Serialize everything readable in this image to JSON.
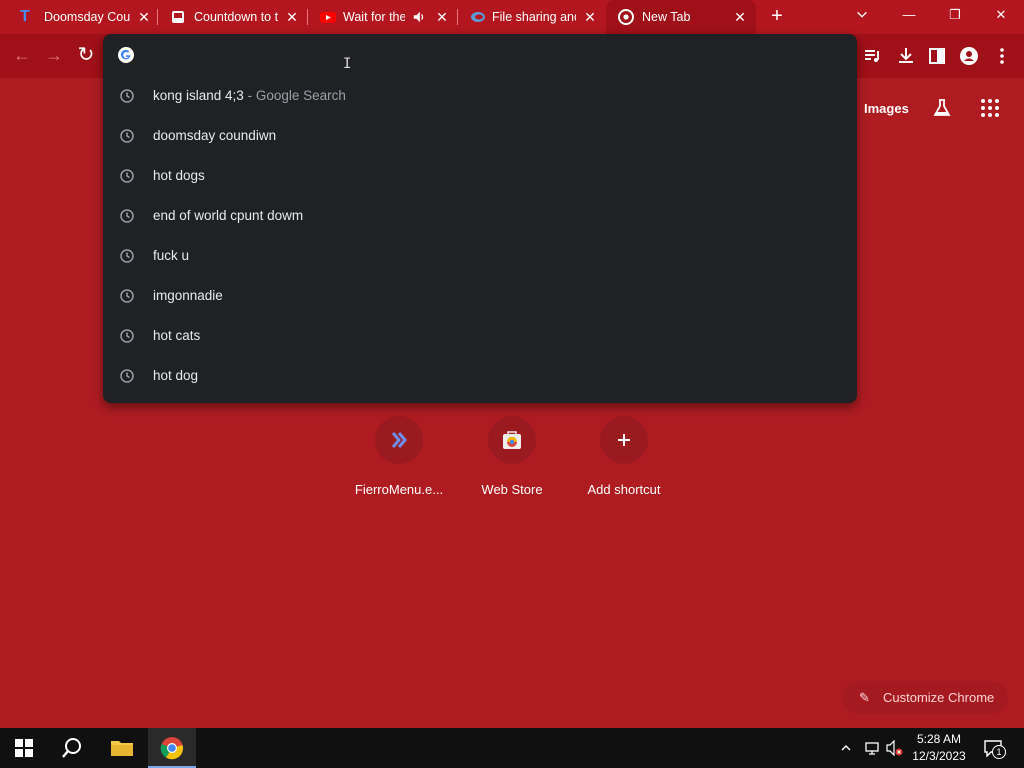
{
  "tabs": [
    {
      "title": "Doomsday Cou",
      "icon": "t-letter-icon",
      "active": false
    },
    {
      "title": "Countdown to t",
      "icon": "page-icon",
      "active": false
    },
    {
      "title": "Wait for the",
      "icon": "youtube-icon",
      "active": false,
      "audio": true
    },
    {
      "title": "File sharing and",
      "icon": "edge-icon",
      "active": false
    },
    {
      "title": "New Tab",
      "icon": "chrome-icon",
      "active": true
    }
  ],
  "omnibox": {
    "value": "",
    "suggestions": [
      {
        "text": "kong island 4;3",
        "desc": " - Google Search"
      },
      {
        "text": "doomsday coundiwn",
        "desc": ""
      },
      {
        "text": "hot dogs",
        "desc": ""
      },
      {
        "text": "end of world cpunt dowm",
        "desc": ""
      },
      {
        "text": "fuck u",
        "desc": ""
      },
      {
        "text": "imgonnadie",
        "desc": ""
      },
      {
        "text": "hot cats",
        "desc": ""
      },
      {
        "text": "hot dog",
        "desc": ""
      }
    ]
  },
  "ntp": {
    "images_link": "Images",
    "shortcuts": [
      {
        "label": "FierroMenu.e...",
        "icon": "double-chevron-icon"
      },
      {
        "label": "Web Store",
        "icon": "webstore-icon"
      },
      {
        "label": "Add shortcut",
        "icon": "plus-icon"
      }
    ],
    "customize_label": "Customize Chrome"
  },
  "taskbar": {
    "time": "5:28 AM",
    "date": "12/3/2023",
    "notification_count": "1"
  },
  "colors": {
    "background": "#ae1c22",
    "tabstrip": "#b3161e",
    "dropdown": "#202124",
    "taskbar": "#101010"
  }
}
